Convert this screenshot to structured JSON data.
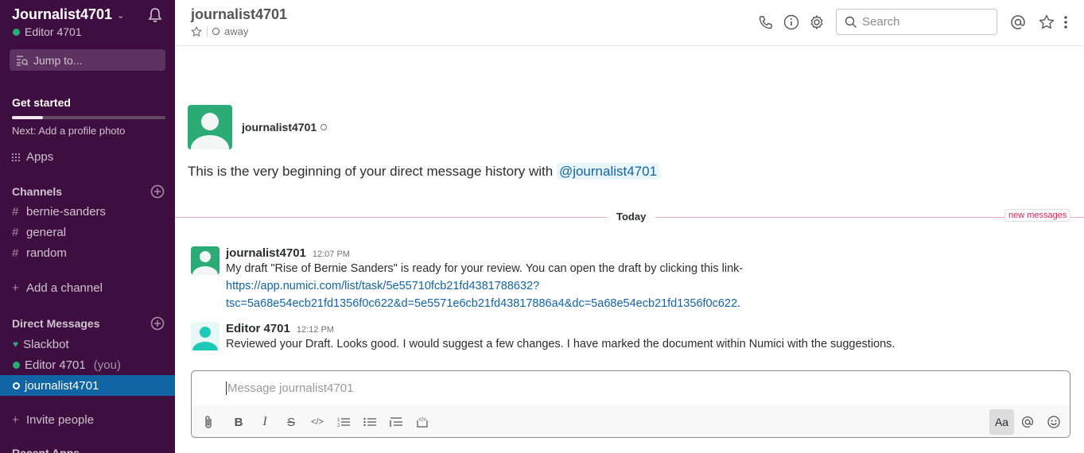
{
  "sidebar": {
    "team_name": "Journalist4701",
    "user_name": "Editor 4701",
    "jump_placeholder": "Jump to...",
    "get_started": {
      "title": "Get started",
      "progress_fraction": 0.2,
      "next_step": "Next: Add a profile photo"
    },
    "apps_label": "Apps",
    "channels": {
      "heading": "Channels",
      "items": [
        {
          "prefix": "#",
          "name": "bernie-sanders"
        },
        {
          "prefix": "#",
          "name": "general"
        },
        {
          "prefix": "#",
          "name": "random"
        }
      ],
      "add_label": "Add a channel"
    },
    "direct_messages": {
      "heading": "Direct Messages",
      "items": [
        {
          "name": "Slackbot",
          "status": "heart",
          "suffix": ""
        },
        {
          "name": "Editor 4701",
          "status": "online",
          "suffix": "(you)"
        },
        {
          "name": "journalist4701",
          "status": "away",
          "suffix": "",
          "active": true
        }
      ],
      "invite_label": "Invite people"
    },
    "cut_heading": "Recent Apps"
  },
  "header": {
    "title": "journalist4701",
    "status": "away",
    "search_placeholder": "Search",
    "icons": [
      "phone-icon",
      "info-icon",
      "gear-icon",
      "at-icon",
      "star-icon",
      "more-icon"
    ]
  },
  "intro": {
    "name": "journalist4701",
    "text": "This is the very beginning of your direct message history with ",
    "mention": "@journalist4701"
  },
  "divider": {
    "label": "Today",
    "new_messages": "new messages"
  },
  "messages": [
    {
      "author": "journalist4701",
      "time": "12:07 PM",
      "text": "My draft \"Rise of Bernie Sanders\" is ready for your review. You can open the draft by clicking this link-",
      "link_line1": "https://app.numici.com/list/task/5e55710fcb21fd4381788632?",
      "link_line2": "tsc=5a68e54ecb21fd1356f0c622&d=5e5571e6cb21fd43817886a4&dc=5a68e54ecb21fd1356f0c622",
      "link_suffix": ".",
      "avatar_color": "#2bac76"
    },
    {
      "author": "Editor 4701",
      "time": "12:12 PM",
      "text": "Reviewed your Draft. Looks good. I would suggest a few changes. I have marked the document within Numici with the suggestions.",
      "avatar_color": "#1dc9b7"
    }
  ],
  "composer": {
    "placeholder": "Message journalist4701",
    "value": "",
    "format_label": "Aa"
  }
}
